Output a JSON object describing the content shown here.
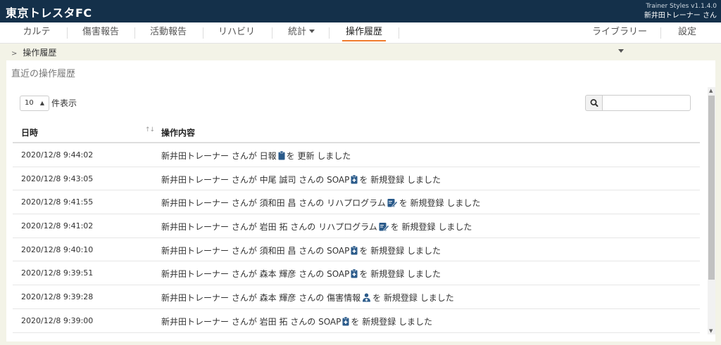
{
  "header": {
    "brand": "東京トレスタFC",
    "version": "Trainer Styles v1.1.4.0",
    "user": "新井田トレーナー さん"
  },
  "nav": {
    "items": [
      "カルテ",
      "傷害報告",
      "活動報告",
      "リハビリ",
      "統計",
      "操作履歴"
    ],
    "library": "ライブラリー",
    "settings": "設定",
    "active": "操作履歴"
  },
  "breadcrumb": {
    "current": "操作履歴"
  },
  "panel": {
    "title": "直近の操作履歴",
    "length_value": "10",
    "length_label": "件表示",
    "search_value": ""
  },
  "table": {
    "columns": [
      "日時",
      "操作内容"
    ],
    "rows": [
      {
        "date": "2020/12/8 9:44:02",
        "pre": "新井田トレーナー さんが 日報",
        "icon": "clipboard-icon",
        "post": "を 更新 しました"
      },
      {
        "date": "2020/12/8 9:43:05",
        "pre": "新井田トレーナー さんが 中尾 誠司 さんの SOAP",
        "icon": "medical-clipboard-icon",
        "post": "を 新規登録 しました"
      },
      {
        "date": "2020/12/8 9:41:55",
        "pre": "新井田トレーナー さんが 須和田 昌 さんの リハプログラム",
        "icon": "edit-document-icon",
        "post": "を 新規登録 しました"
      },
      {
        "date": "2020/12/8 9:41:02",
        "pre": "新井田トレーナー さんが 岩田 拓 さんの リハプログラム",
        "icon": "edit-document-icon",
        "post": "を 新規登録 しました"
      },
      {
        "date": "2020/12/8 9:40:10",
        "pre": "新井田トレーナー さんが 須和田 昌 さんの SOAP",
        "icon": "medical-clipboard-icon",
        "post": "を 新規登録 しました"
      },
      {
        "date": "2020/12/8 9:39:51",
        "pre": "新井田トレーナー さんが 森本 輝彦 さんの SOAP",
        "icon": "medical-clipboard-icon",
        "post": "を 新規登録 しました"
      },
      {
        "date": "2020/12/8 9:39:28",
        "pre": "新井田トレーナー さんが 森本 輝彦 さんの 傷害情報",
        "icon": "injured-user-icon",
        "post": "を 新規登録 しました"
      },
      {
        "date": "2020/12/8 9:39:00",
        "pre": "新井田トレーナー さんが 岩田 拓 さんの SOAP",
        "icon": "medical-clipboard-icon",
        "post": "を 新規登録 しました"
      }
    ]
  },
  "colors": {
    "topbar": "#14304a",
    "accent": "#f07a2c",
    "icon": "#2a5a8a"
  }
}
